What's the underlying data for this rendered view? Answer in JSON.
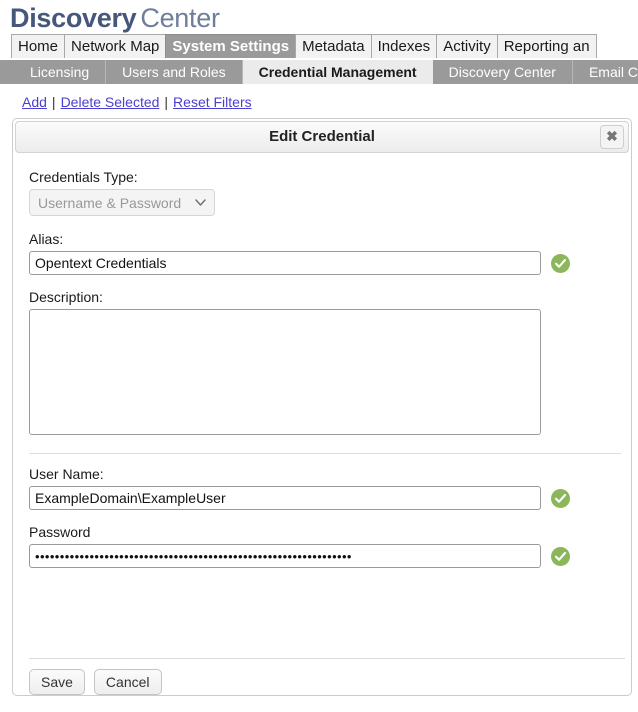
{
  "brand": {
    "bold": "Discovery",
    "light": "Center",
    "bold_color": "#46577c",
    "light_color": "#6e7e9c"
  },
  "tabs": [
    {
      "label": "Home",
      "active": false
    },
    {
      "label": "Network Map",
      "active": false
    },
    {
      "label": "System Settings",
      "active": true
    },
    {
      "label": "Metadata",
      "active": false
    },
    {
      "label": "Indexes",
      "active": false
    },
    {
      "label": "Activity",
      "active": false
    },
    {
      "label": "Reporting an",
      "active": false
    }
  ],
  "subtabs": [
    {
      "label": "Licensing",
      "active": false
    },
    {
      "label": "Users and Roles",
      "active": false
    },
    {
      "label": "Credential Management",
      "active": true
    },
    {
      "label": "Discovery Center",
      "active": false
    },
    {
      "label": "Email C",
      "active": false
    }
  ],
  "actions": {
    "add": "Add",
    "delete_selected": "Delete Selected",
    "reset_filters": "Reset Filters",
    "separator": "|",
    "link_color": "#4b3fd0"
  },
  "panel": {
    "title": "Edit Credential",
    "close_icon": "✖"
  },
  "form": {
    "credentials_type": {
      "label": "Credentials Type:",
      "value": "Username & Password",
      "options": [
        "Username & Password"
      ],
      "caret_icon": "chevron-down-icon",
      "caret_glyph": "⌄",
      "disabled": true
    },
    "alias": {
      "label": "Alias:",
      "value": "Opentext Credentials",
      "placeholder": "",
      "valid": true
    },
    "description": {
      "label": "Description:",
      "value": "",
      "placeholder": ""
    },
    "user_name": {
      "label": "User Name:",
      "value": "ExampleDomain\\ExampleUser",
      "placeholder": "",
      "valid": true
    },
    "password": {
      "label": "Password",
      "value": "••••••••••••••••••••••••••••••••••••••••••••••••••••••••••••••••",
      "placeholder": "",
      "valid": true
    },
    "valid_icon": "check-circle-icon",
    "valid_color": "#8cb65a"
  },
  "footer": {
    "save": "Save",
    "cancel": "Cancel"
  }
}
